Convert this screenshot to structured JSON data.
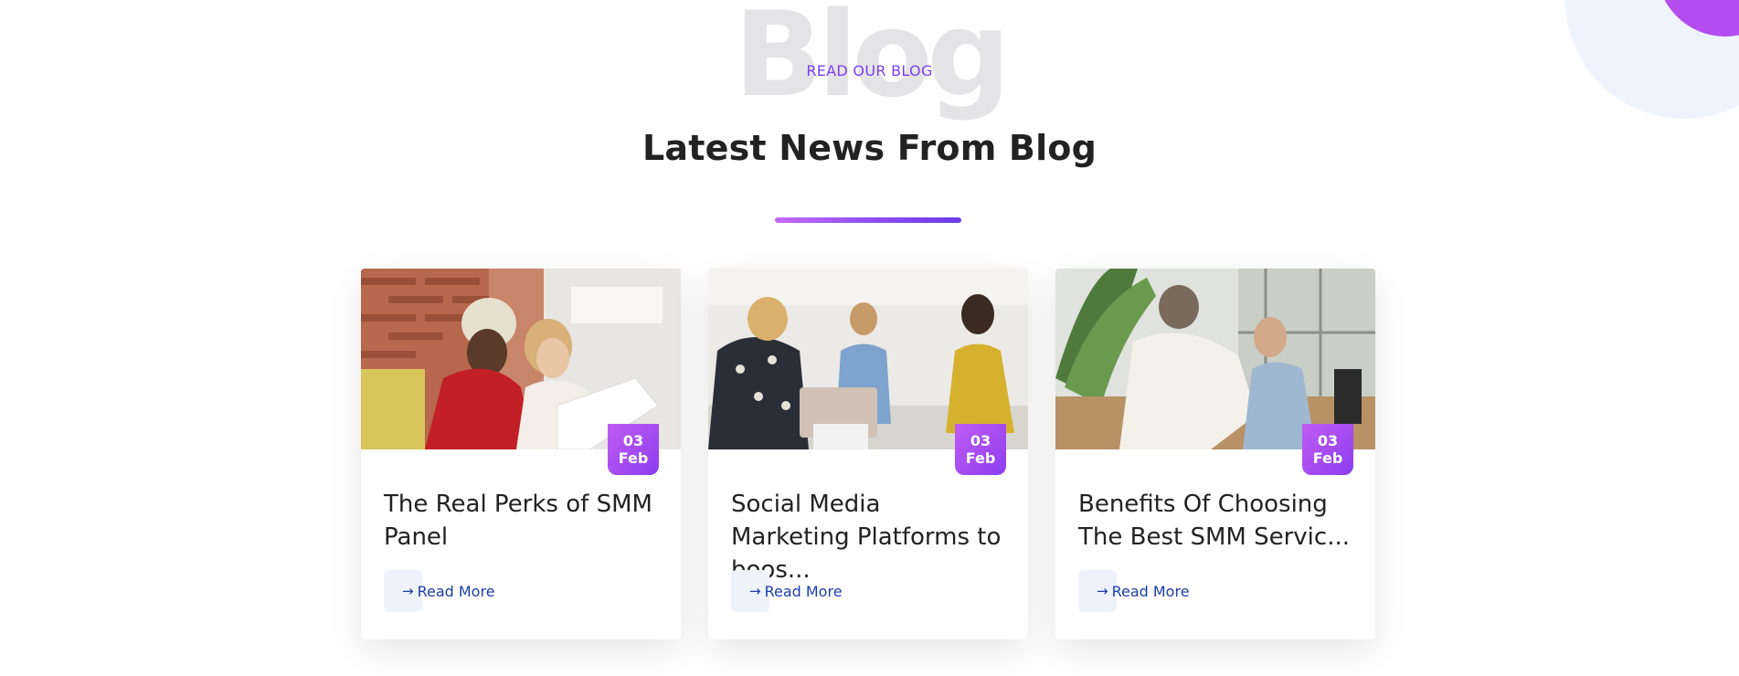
{
  "section": {
    "background_word": "Blog",
    "eyebrow": "READ OUR BLOG",
    "heading": "Latest News From Blog"
  },
  "colors": {
    "accent_purple": "#8c3df0",
    "link_blue": "#1c3da8",
    "heading": "#222222"
  },
  "posts": [
    {
      "image_alt": "Two colleagues reviewing a document",
      "date_day": "03",
      "date_month": "Feb",
      "title": "The Real Perks of SMM Panel",
      "read_more": "Read More",
      "arrow_icon": "arrow-right-icon"
    },
    {
      "image_alt": "Team meeting around a laptop",
      "date_day": "03",
      "date_month": "Feb",
      "title": "Social Media Marketing Platforms to boos...",
      "read_more": "Read More",
      "arrow_icon": "arrow-right-icon"
    },
    {
      "image_alt": "Two people working at a computer",
      "date_day": "03",
      "date_month": "Feb",
      "title": "Benefits Of Choosing The Best SMM Servic...",
      "read_more": "Read More",
      "arrow_icon": "arrow-right-icon"
    }
  ]
}
